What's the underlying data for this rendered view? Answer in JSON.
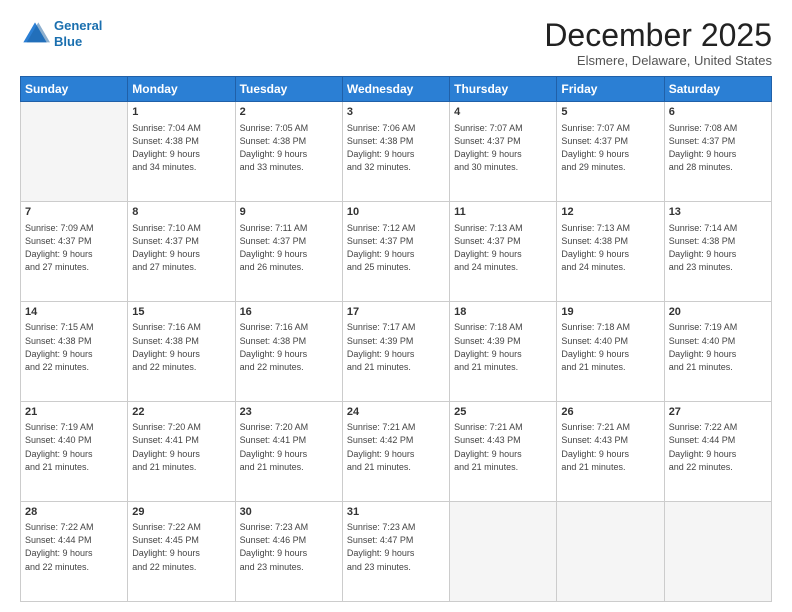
{
  "header": {
    "logo_line1": "General",
    "logo_line2": "Blue",
    "month_title": "December 2025",
    "location": "Elsmere, Delaware, United States"
  },
  "weekdays": [
    "Sunday",
    "Monday",
    "Tuesday",
    "Wednesday",
    "Thursday",
    "Friday",
    "Saturday"
  ],
  "weeks": [
    [
      {
        "day": "",
        "sunrise": "",
        "sunset": "",
        "daylight": ""
      },
      {
        "day": "1",
        "sunrise": "Sunrise: 7:04 AM",
        "sunset": "Sunset: 4:38 PM",
        "daylight": "Daylight: 9 hours and 34 minutes."
      },
      {
        "day": "2",
        "sunrise": "Sunrise: 7:05 AM",
        "sunset": "Sunset: 4:38 PM",
        "daylight": "Daylight: 9 hours and 33 minutes."
      },
      {
        "day": "3",
        "sunrise": "Sunrise: 7:06 AM",
        "sunset": "Sunset: 4:38 PM",
        "daylight": "Daylight: 9 hours and 32 minutes."
      },
      {
        "day": "4",
        "sunrise": "Sunrise: 7:07 AM",
        "sunset": "Sunset: 4:37 PM",
        "daylight": "Daylight: 9 hours and 30 minutes."
      },
      {
        "day": "5",
        "sunrise": "Sunrise: 7:07 AM",
        "sunset": "Sunset: 4:37 PM",
        "daylight": "Daylight: 9 hours and 29 minutes."
      },
      {
        "day": "6",
        "sunrise": "Sunrise: 7:08 AM",
        "sunset": "Sunset: 4:37 PM",
        "daylight": "Daylight: 9 hours and 28 minutes."
      }
    ],
    [
      {
        "day": "7",
        "sunrise": "Sunrise: 7:09 AM",
        "sunset": "Sunset: 4:37 PM",
        "daylight": "Daylight: 9 hours and 27 minutes."
      },
      {
        "day": "8",
        "sunrise": "Sunrise: 7:10 AM",
        "sunset": "Sunset: 4:37 PM",
        "daylight": "Daylight: 9 hours and 27 minutes."
      },
      {
        "day": "9",
        "sunrise": "Sunrise: 7:11 AM",
        "sunset": "Sunset: 4:37 PM",
        "daylight": "Daylight: 9 hours and 26 minutes."
      },
      {
        "day": "10",
        "sunrise": "Sunrise: 7:12 AM",
        "sunset": "Sunset: 4:37 PM",
        "daylight": "Daylight: 9 hours and 25 minutes."
      },
      {
        "day": "11",
        "sunrise": "Sunrise: 7:13 AM",
        "sunset": "Sunset: 4:37 PM",
        "daylight": "Daylight: 9 hours and 24 minutes."
      },
      {
        "day": "12",
        "sunrise": "Sunrise: 7:13 AM",
        "sunset": "Sunset: 4:38 PM",
        "daylight": "Daylight: 9 hours and 24 minutes."
      },
      {
        "day": "13",
        "sunrise": "Sunrise: 7:14 AM",
        "sunset": "Sunset: 4:38 PM",
        "daylight": "Daylight: 9 hours and 23 minutes."
      }
    ],
    [
      {
        "day": "14",
        "sunrise": "Sunrise: 7:15 AM",
        "sunset": "Sunset: 4:38 PM",
        "daylight": "Daylight: 9 hours and 22 minutes."
      },
      {
        "day": "15",
        "sunrise": "Sunrise: 7:16 AM",
        "sunset": "Sunset: 4:38 PM",
        "daylight": "Daylight: 9 hours and 22 minutes."
      },
      {
        "day": "16",
        "sunrise": "Sunrise: 7:16 AM",
        "sunset": "Sunset: 4:38 PM",
        "daylight": "Daylight: 9 hours and 22 minutes."
      },
      {
        "day": "17",
        "sunrise": "Sunrise: 7:17 AM",
        "sunset": "Sunset: 4:39 PM",
        "daylight": "Daylight: 9 hours and 21 minutes."
      },
      {
        "day": "18",
        "sunrise": "Sunrise: 7:18 AM",
        "sunset": "Sunset: 4:39 PM",
        "daylight": "Daylight: 9 hours and 21 minutes."
      },
      {
        "day": "19",
        "sunrise": "Sunrise: 7:18 AM",
        "sunset": "Sunset: 4:40 PM",
        "daylight": "Daylight: 9 hours and 21 minutes."
      },
      {
        "day": "20",
        "sunrise": "Sunrise: 7:19 AM",
        "sunset": "Sunset: 4:40 PM",
        "daylight": "Daylight: 9 hours and 21 minutes."
      }
    ],
    [
      {
        "day": "21",
        "sunrise": "Sunrise: 7:19 AM",
        "sunset": "Sunset: 4:40 PM",
        "daylight": "Daylight: 9 hours and 21 minutes."
      },
      {
        "day": "22",
        "sunrise": "Sunrise: 7:20 AM",
        "sunset": "Sunset: 4:41 PM",
        "daylight": "Daylight: 9 hours and 21 minutes."
      },
      {
        "day": "23",
        "sunrise": "Sunrise: 7:20 AM",
        "sunset": "Sunset: 4:41 PM",
        "daylight": "Daylight: 9 hours and 21 minutes."
      },
      {
        "day": "24",
        "sunrise": "Sunrise: 7:21 AM",
        "sunset": "Sunset: 4:42 PM",
        "daylight": "Daylight: 9 hours and 21 minutes."
      },
      {
        "day": "25",
        "sunrise": "Sunrise: 7:21 AM",
        "sunset": "Sunset: 4:43 PM",
        "daylight": "Daylight: 9 hours and 21 minutes."
      },
      {
        "day": "26",
        "sunrise": "Sunrise: 7:21 AM",
        "sunset": "Sunset: 4:43 PM",
        "daylight": "Daylight: 9 hours and 21 minutes."
      },
      {
        "day": "27",
        "sunrise": "Sunrise: 7:22 AM",
        "sunset": "Sunset: 4:44 PM",
        "daylight": "Daylight: 9 hours and 22 minutes."
      }
    ],
    [
      {
        "day": "28",
        "sunrise": "Sunrise: 7:22 AM",
        "sunset": "Sunset: 4:44 PM",
        "daylight": "Daylight: 9 hours and 22 minutes."
      },
      {
        "day": "29",
        "sunrise": "Sunrise: 7:22 AM",
        "sunset": "Sunset: 4:45 PM",
        "daylight": "Daylight: 9 hours and 22 minutes."
      },
      {
        "day": "30",
        "sunrise": "Sunrise: 7:23 AM",
        "sunset": "Sunset: 4:46 PM",
        "daylight": "Daylight: 9 hours and 23 minutes."
      },
      {
        "day": "31",
        "sunrise": "Sunrise: 7:23 AM",
        "sunset": "Sunset: 4:47 PM",
        "daylight": "Daylight: 9 hours and 23 minutes."
      },
      {
        "day": "",
        "sunrise": "",
        "sunset": "",
        "daylight": ""
      },
      {
        "day": "",
        "sunrise": "",
        "sunset": "",
        "daylight": ""
      },
      {
        "day": "",
        "sunrise": "",
        "sunset": "",
        "daylight": ""
      }
    ]
  ]
}
